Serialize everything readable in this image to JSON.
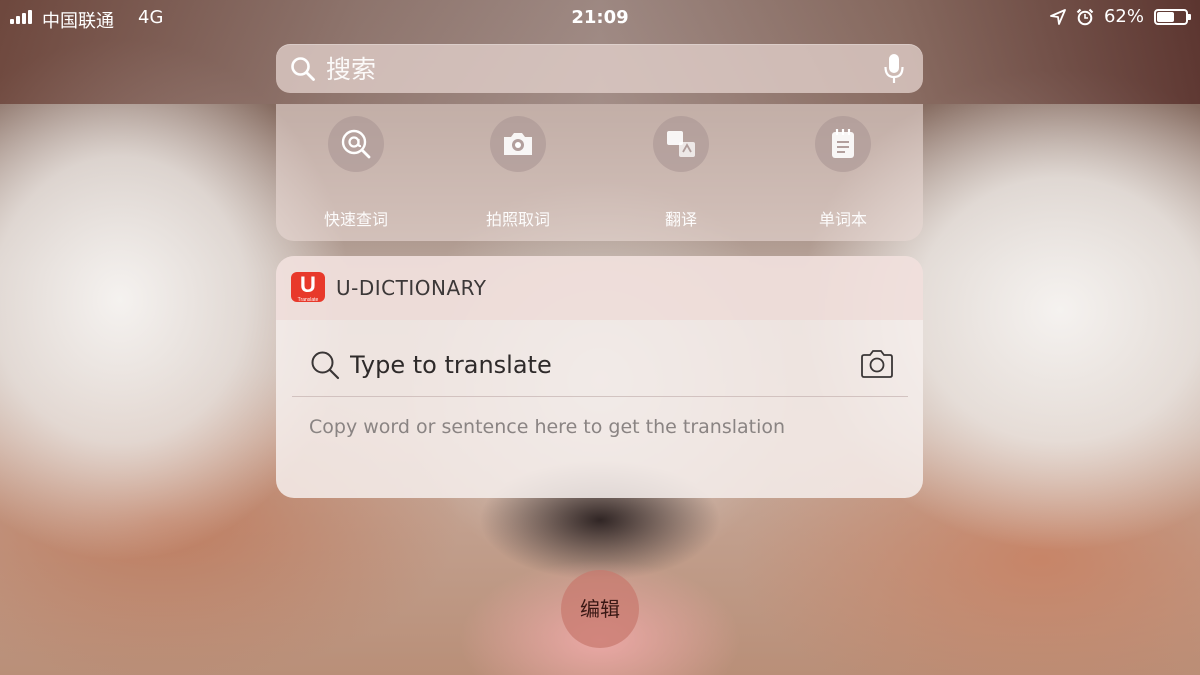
{
  "status_bar": {
    "carrier": "中国联通",
    "network": "4G",
    "time": "21:09",
    "battery_percent": "62%",
    "battery_level": 0.62,
    "icons": [
      "signal-icon",
      "location-arrow-icon",
      "alarm-icon",
      "battery-icon"
    ]
  },
  "search": {
    "placeholder": "搜索",
    "icon": "search-icon",
    "mic_icon": "microphone-icon"
  },
  "shortcuts": {
    "items": [
      {
        "label": "快速查词",
        "icon": "at-magnifier-icon"
      },
      {
        "label": "拍照取词",
        "icon": "camera-icon"
      },
      {
        "label": "翻译",
        "icon": "translate-icon"
      },
      {
        "label": "单词本",
        "icon": "notebook-icon"
      }
    ]
  },
  "udict": {
    "app_name": "U-DICTIONARY",
    "logo_letter": "U",
    "logo_caption": "Translate",
    "input_placeholder": "Type to translate",
    "hint": "Copy word or sentence here to get the translation",
    "camera_icon": "camera-icon",
    "accent_color": "#e8392b"
  },
  "edit_button": {
    "label": "编辑"
  }
}
